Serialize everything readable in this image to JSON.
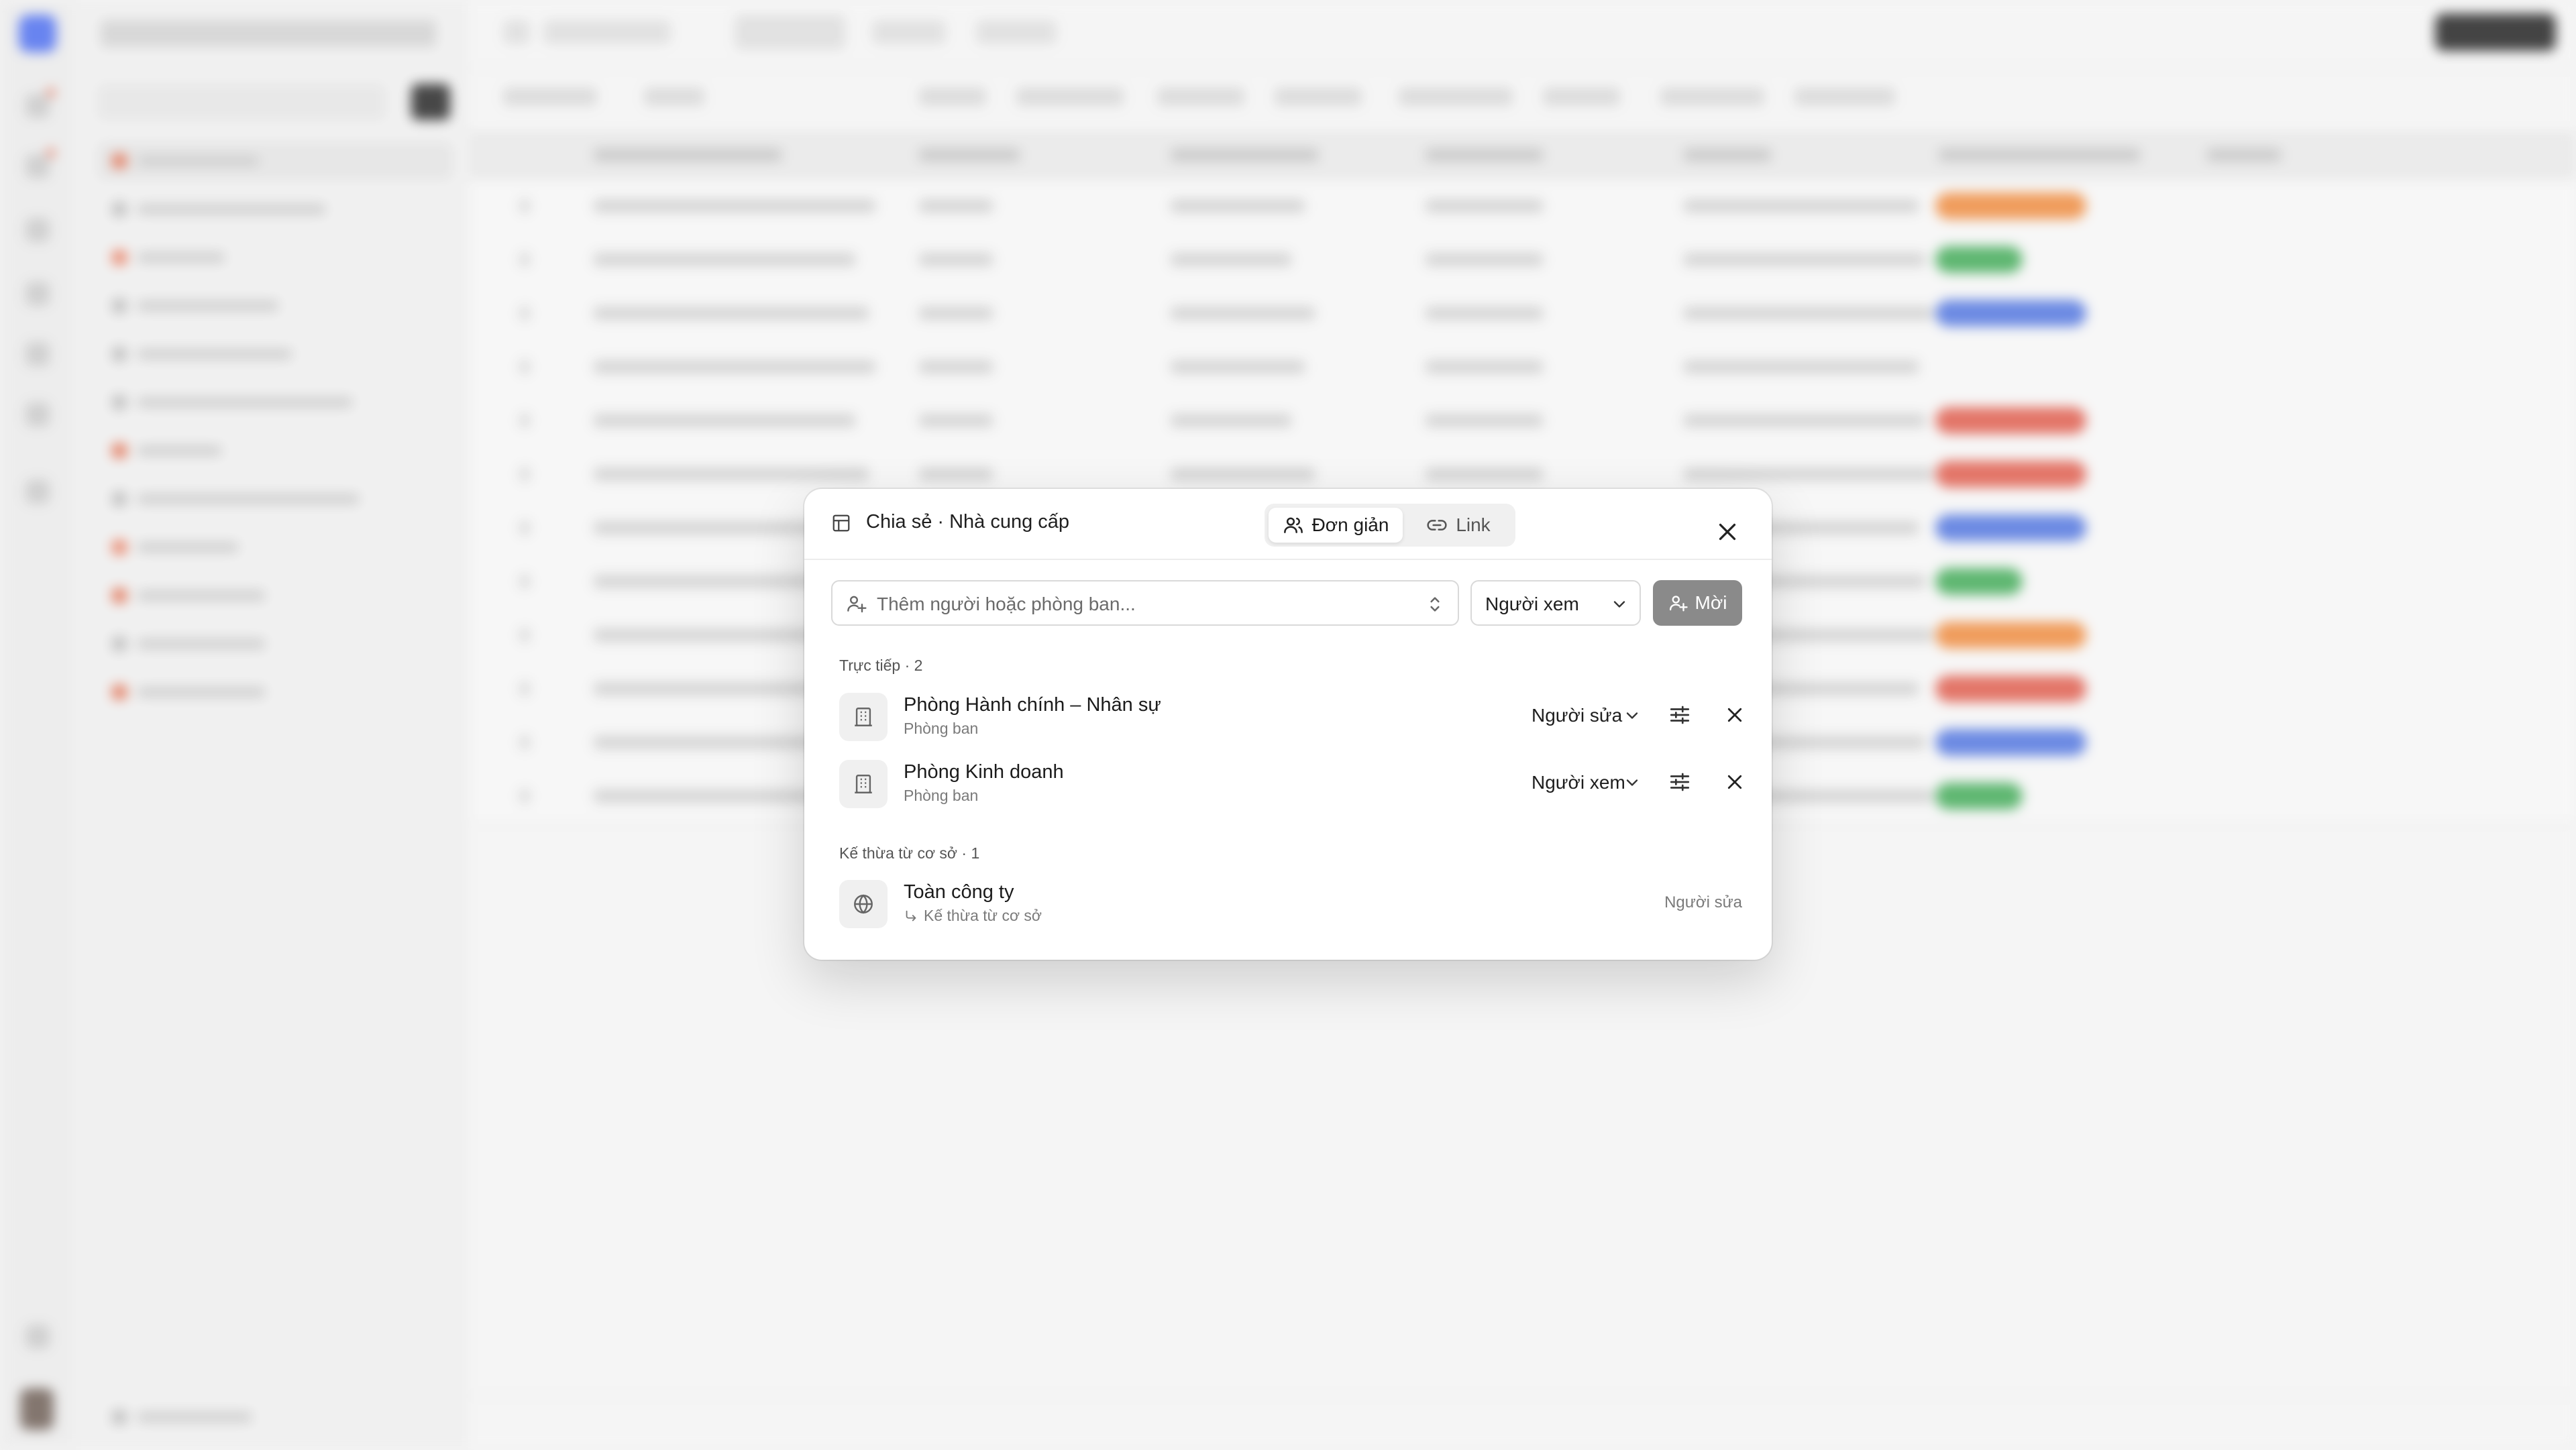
{
  "dialog": {
    "title": "Chia sẻ · Nhà cung cấp",
    "mode_tabs": [
      {
        "label": "Đơn giản",
        "icon": "users-icon",
        "active": true
      },
      {
        "label": "Link",
        "icon": "link-icon",
        "active": false
      }
    ],
    "add_input": {
      "placeholder": "Thêm người hoặc phòng ban..."
    },
    "role_select": {
      "value": "Người xem"
    },
    "new_button": {
      "label": "Mời"
    },
    "direct_section": {
      "label": "Trực tiếp · 2",
      "entries": [
        {
          "name": "Phòng Hành chính – Nhân sự",
          "type": "Phòng ban",
          "role": "Người sửa",
          "icon": "building-icon"
        },
        {
          "name": "Phòng Kinh doanh",
          "type": "Phòng ban",
          "role": "Người xem",
          "icon": "building-icon"
        }
      ]
    },
    "inherited_section": {
      "label": "Kế thừa từ cơ sở · 1",
      "entries": [
        {
          "name": "Toàn công ty",
          "note": "Kế thừa từ cơ sở",
          "role": "Người sửa",
          "icon": "globe-icon"
        }
      ]
    }
  },
  "colors": {
    "accent": "#4a6cf0",
    "new_button_bg": "#8a8a8a",
    "pill_orange": "#f08a3c",
    "pill_green": "#3faa55",
    "pill_blue": "#4f74e0",
    "pill_red": "#e05a4a"
  },
  "background": {
    "row_pills": [
      "orange",
      "green",
      "blue",
      "none",
      "red",
      "red",
      "blue",
      "green",
      "orange",
      "red",
      "blue",
      "green"
    ]
  }
}
